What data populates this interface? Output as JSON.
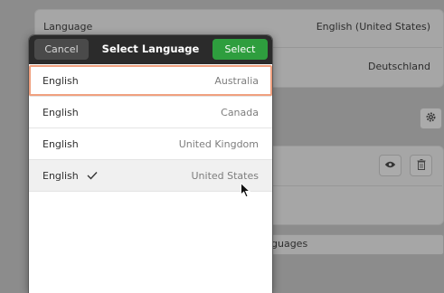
{
  "settings": {
    "language_label": "Language",
    "language_value": "English (United States)",
    "formats_value": "Deutschland",
    "manage_languages_label": "guages"
  },
  "dialog": {
    "title": "Select Language",
    "cancel_label": "Cancel",
    "select_label": "Select",
    "rows": [
      {
        "language": "English",
        "region": "Australia",
        "focused": true,
        "selected": false
      },
      {
        "language": "English",
        "region": "Canada",
        "focused": false,
        "selected": false
      },
      {
        "language": "English",
        "region": "United Kingdom",
        "focused": false,
        "selected": false
      },
      {
        "language": "English",
        "region": "United States",
        "focused": false,
        "selected": true
      }
    ]
  },
  "colors": {
    "header_bg": "#2b2b2b",
    "select_button": "#2e9e3e",
    "focus_outline": "#f0a07f",
    "backdrop": "#8c8c8c"
  },
  "icons": [
    "gear-icon",
    "eye-icon",
    "trash-icon",
    "checkmark-icon",
    "mouse-cursor-icon"
  ]
}
